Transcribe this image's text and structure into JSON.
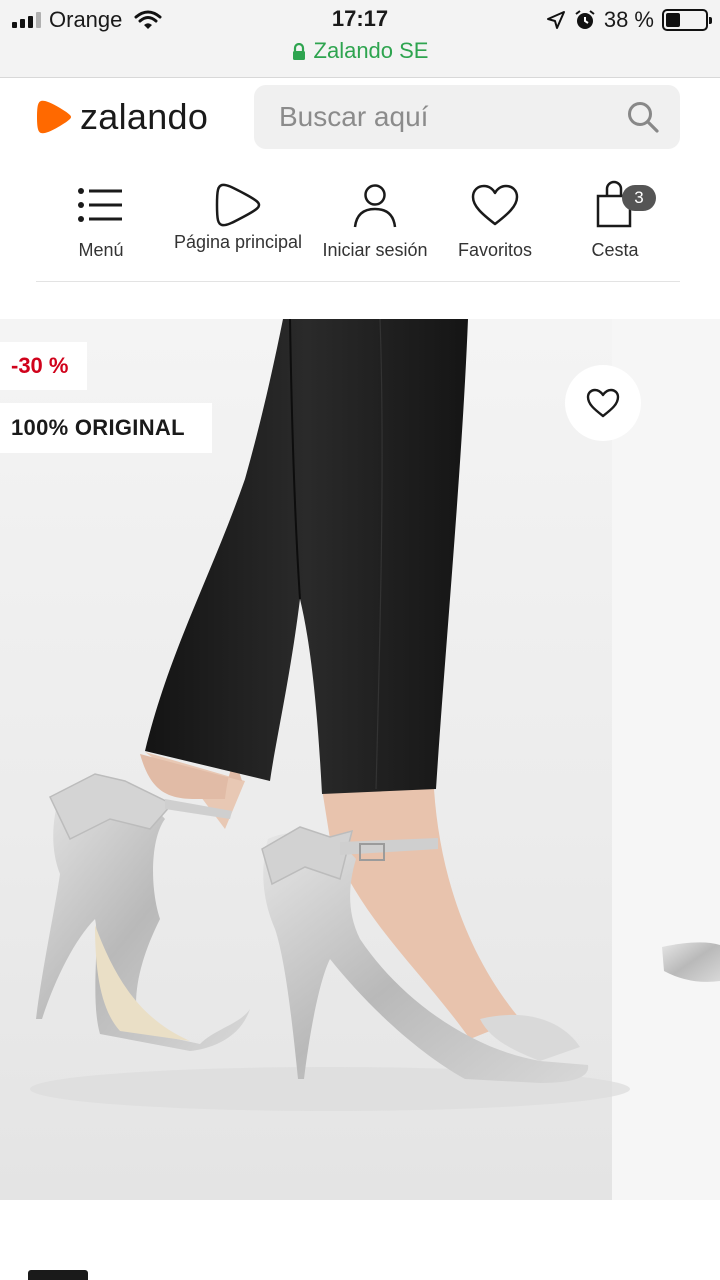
{
  "status_bar": {
    "carrier": "Orange",
    "time": "17:17",
    "battery_percent": "38 %",
    "battery_level": 0.38,
    "url": "Zalando SE"
  },
  "header": {
    "logo_text": "zalando",
    "search_placeholder": "Buscar aquí"
  },
  "nav": {
    "items": [
      {
        "label": "Menú",
        "icon": "menu-icon"
      },
      {
        "label": "Página principal",
        "icon": "home-icon"
      },
      {
        "label": "Iniciar sesión",
        "icon": "user-icon"
      },
      {
        "label": "Favoritos",
        "icon": "heart-icon"
      },
      {
        "label": "Cesta",
        "icon": "bag-icon",
        "badge": "3"
      }
    ]
  },
  "product": {
    "discount_tag": "-30 %",
    "original_tag": "100% ORIGINAL"
  },
  "colors": {
    "brand_orange": "#ff6900",
    "discount_red": "#d0021b",
    "secure_green": "#2ea44f"
  }
}
